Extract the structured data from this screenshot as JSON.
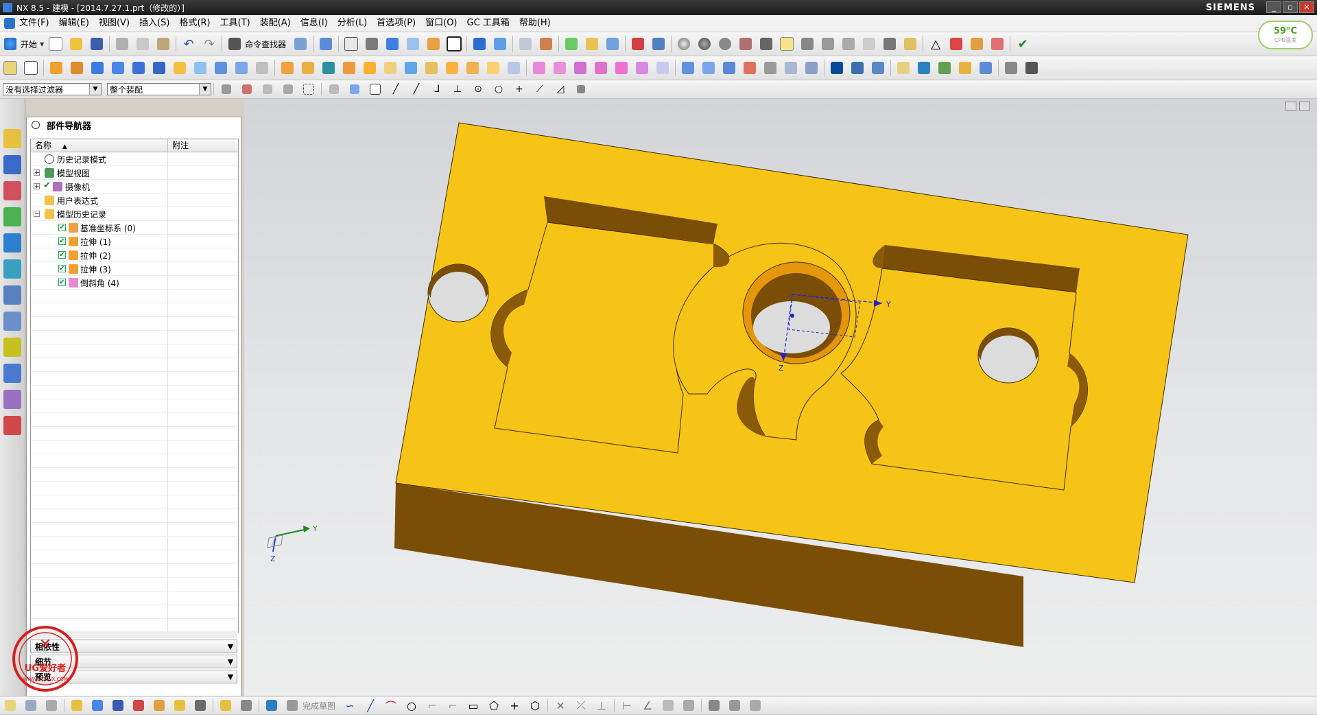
{
  "titlebar": {
    "title": "NX 8.5 - 建模 - [2014.7.27.1.prt（修改的）]",
    "brand": "SIEMENS"
  },
  "menubar": {
    "items": [
      "文件(F)",
      "编辑(E)",
      "视图(V)",
      "插入(S)",
      "格式(R)",
      "工具(T)",
      "装配(A)",
      "信息(I)",
      "分析(L)",
      "首选项(P)",
      "窗口(O)",
      "GC 工具箱",
      "帮助(H)"
    ]
  },
  "toolbar1": {
    "start_label": "开始",
    "command_finder_label": "命令查找器"
  },
  "toolbar3": {
    "selection_filter": "没有选择过滤器",
    "scope": "整个装配"
  },
  "temp_badge": {
    "value": "59°C",
    "label": "CPU温度"
  },
  "navigator": {
    "title": "部件导航器",
    "col_name": "名称",
    "col_note": "附注",
    "rows": [
      {
        "label": "历史记录模式"
      },
      {
        "label": "模型视图"
      },
      {
        "label": "摄像机"
      },
      {
        "label": "用户表达式"
      },
      {
        "label": "模型历史记录"
      },
      {
        "label": "基准坐标系 (0)"
      },
      {
        "label": "拉伸 (1)"
      },
      {
        "label": "拉伸 (2)"
      },
      {
        "label": "拉伸 (3)"
      },
      {
        "label": "倒斜角 (4)"
      }
    ],
    "panels": [
      "相依性",
      "细节",
      "预览"
    ]
  },
  "bottom_toolbar": {
    "finish_sketch_label": "完成草图"
  },
  "viewport": {
    "part_color": "#F6C416",
    "part_side_color": "#7A4E06",
    "axis_labels": {
      "y": "Y",
      "z": "Z"
    }
  },
  "watermark": {
    "text": "UG爱好者",
    "url": "WWW.UGSNX.COM"
  }
}
